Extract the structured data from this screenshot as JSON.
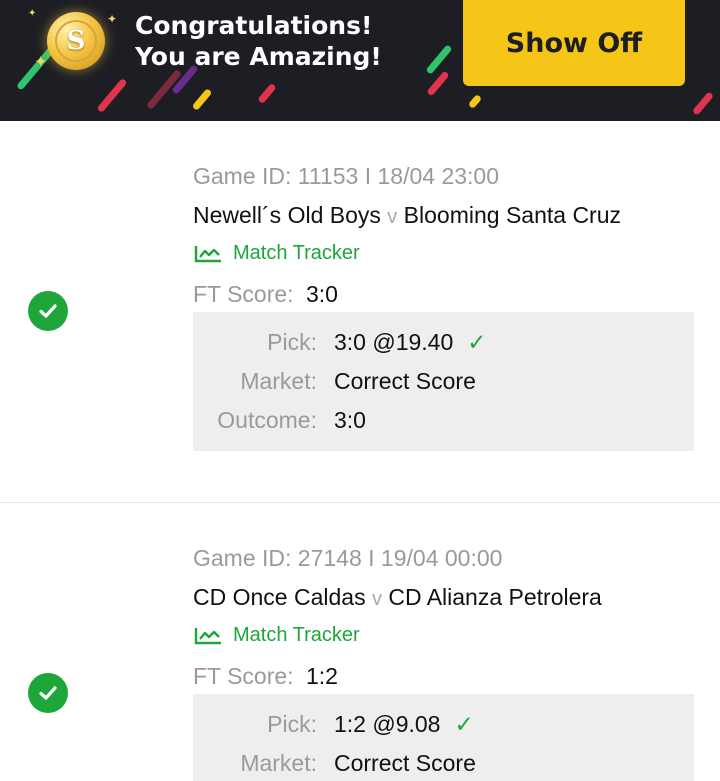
{
  "banner": {
    "title_line1": "Congratulations!",
    "title_line2": "You are Amazing!",
    "coin_symbol": "S",
    "show_off_label": "Show Off",
    "colors": {
      "background": "#1d1e24",
      "button": "#f5c518"
    }
  },
  "bets": [
    {
      "game_meta": "Game ID: 11153 I 18/04 23:00",
      "home": "Newell´s Old Boys",
      "vs": "v",
      "away": "Blooming Santa Cruz",
      "tracker_label": "Match Tracker",
      "ft_label": "FT Score:",
      "ft_score": "3:0",
      "pick_label": "Pick:",
      "pick_value": "3:0 @19.40",
      "market_label": "Market:",
      "market_value": "Correct Score",
      "outcome_label": "Outcome:",
      "outcome_value": "3:0",
      "status": "won"
    },
    {
      "game_meta": "Game ID: 27148 I 19/04 00:00",
      "home": "CD Once Caldas",
      "vs": "v",
      "away": "CD Alianza Petrolera",
      "tracker_label": "Match Tracker",
      "ft_label": "FT Score:",
      "ft_score": "1:2",
      "pick_label": "Pick:",
      "pick_value": "1:2 @9.08",
      "market_label": "Market:",
      "market_value": "Correct Score",
      "status": "won"
    }
  ],
  "colors": {
    "accent_green": "#1ea63a",
    "muted_text": "#9a9a9a",
    "pick_box": "#eeeeef"
  }
}
